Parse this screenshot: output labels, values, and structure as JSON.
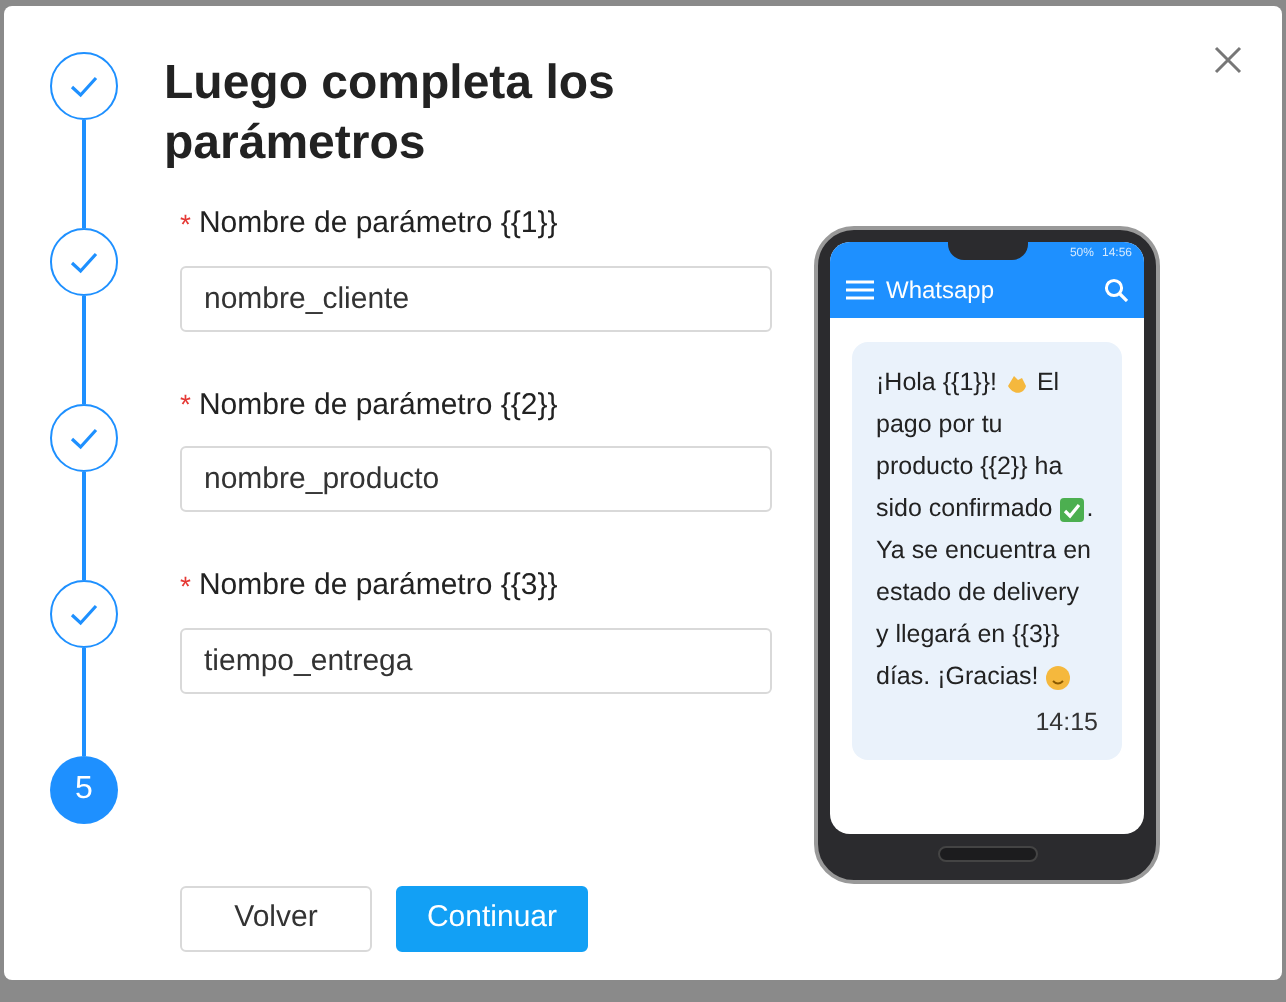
{
  "steps": [
    {
      "kind": "done"
    },
    {
      "kind": "done"
    },
    {
      "kind": "done"
    },
    {
      "kind": "done"
    },
    {
      "kind": "current",
      "number": "5"
    }
  ],
  "title": "Luego completa los parámetros",
  "fields": [
    {
      "label": "Nombre de parámetro {{1}}",
      "required": true,
      "value": "nombre_cliente"
    },
    {
      "label": "Nombre de parámetro {{2}}",
      "required": true,
      "value": "nombre_producto"
    },
    {
      "label": "Nombre de parámetro {{3}}",
      "required": true,
      "value": "tiempo_entrega"
    }
  ],
  "required_mark": "*",
  "phone": {
    "status": {
      "battery": "50%",
      "time": "14:56"
    },
    "app_title": "Whatsapp",
    "message_lines": [
      [
        {
          "kind": "text",
          "text": "¡Hola {{1}}!"
        },
        {
          "kind": "wave"
        },
        {
          "kind": "text",
          "text": "El"
        }
      ],
      [
        {
          "kind": "text",
          "text": "pago por tu"
        }
      ],
      [
        {
          "kind": "text",
          "text": "producto {{2}} ha"
        }
      ],
      [
        {
          "kind": "text",
          "text": "sido confirmado"
        },
        {
          "kind": "check"
        },
        {
          "kind": "text",
          "text": "."
        }
      ],
      [
        {
          "kind": "text",
          "text": "Ya se encuentra en"
        }
      ],
      [
        {
          "kind": "text",
          "text": "estado de delivery"
        }
      ],
      [
        {
          "kind": "text",
          "text": "y llegará en {{3}}"
        }
      ],
      [
        {
          "kind": "text",
          "text": "días. ¡Gracias!"
        },
        {
          "kind": "smile"
        }
      ]
    ],
    "message_time": "14:15"
  },
  "buttons": [
    {
      "label": "Volver",
      "kind": "secondary"
    },
    {
      "label": "Continuar",
      "kind": "primary"
    }
  ]
}
